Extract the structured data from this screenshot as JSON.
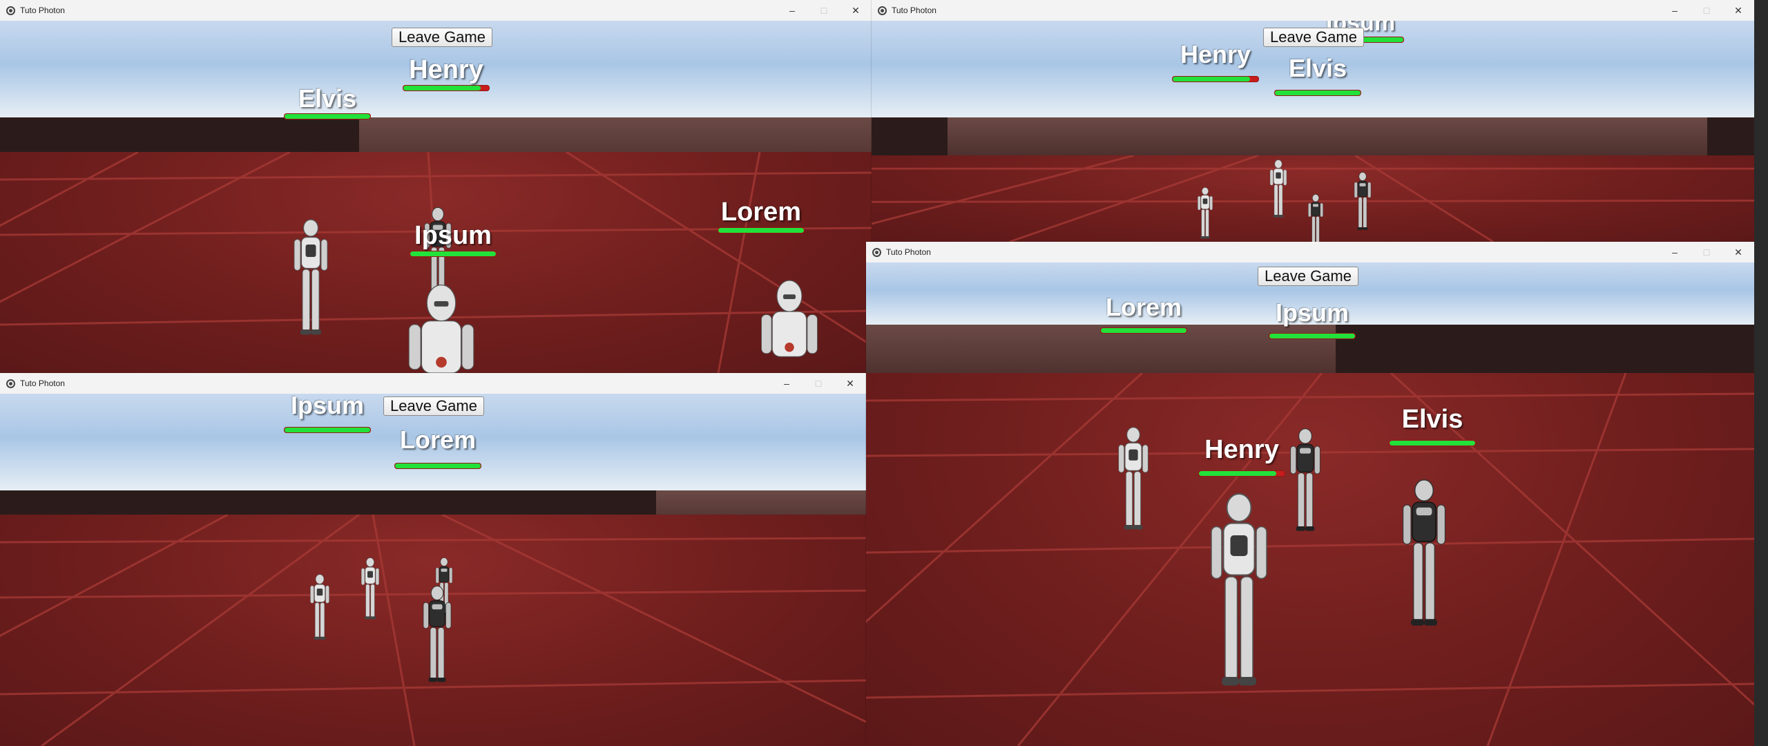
{
  "window_title": "Tuto Photon",
  "leave_label": "Leave Game",
  "controls": {
    "minimize": "–",
    "maximize": "□",
    "close": "✕"
  },
  "icons": {
    "app": "unity-icon",
    "minimize": "minimize-icon",
    "maximize": "maximize-icon",
    "close": "close-icon"
  },
  "colors": {
    "health_green": "#22e13a",
    "health_red": "#c81d1d",
    "floor": "#6e1e1d"
  },
  "windows": [
    {
      "id": "top-left",
      "players": [
        {
          "name": "Elvis",
          "health": 1.0
        },
        {
          "name": "Henry",
          "health": 0.9
        },
        {
          "name": "Ipsum",
          "health": 1.0
        },
        {
          "name": "Lorem",
          "health": 1.0
        }
      ]
    },
    {
      "id": "top-right",
      "players": [
        {
          "name": "Ipsum",
          "health": 1.0
        },
        {
          "name": "Henry",
          "health": 0.9
        },
        {
          "name": "Elvis",
          "health": 1.0
        }
      ]
    },
    {
      "id": "bottom-left",
      "players": [
        {
          "name": "Ipsum",
          "health": 1.0
        },
        {
          "name": "Lorem",
          "health": 1.0
        }
      ]
    },
    {
      "id": "bottom-right",
      "players": [
        {
          "name": "Lorem",
          "health": 1.0
        },
        {
          "name": "Ipsum",
          "health": 1.0
        },
        {
          "name": "Elvis",
          "health": 1.0
        },
        {
          "name": "Henry",
          "health": 0.9
        }
      ]
    }
  ]
}
